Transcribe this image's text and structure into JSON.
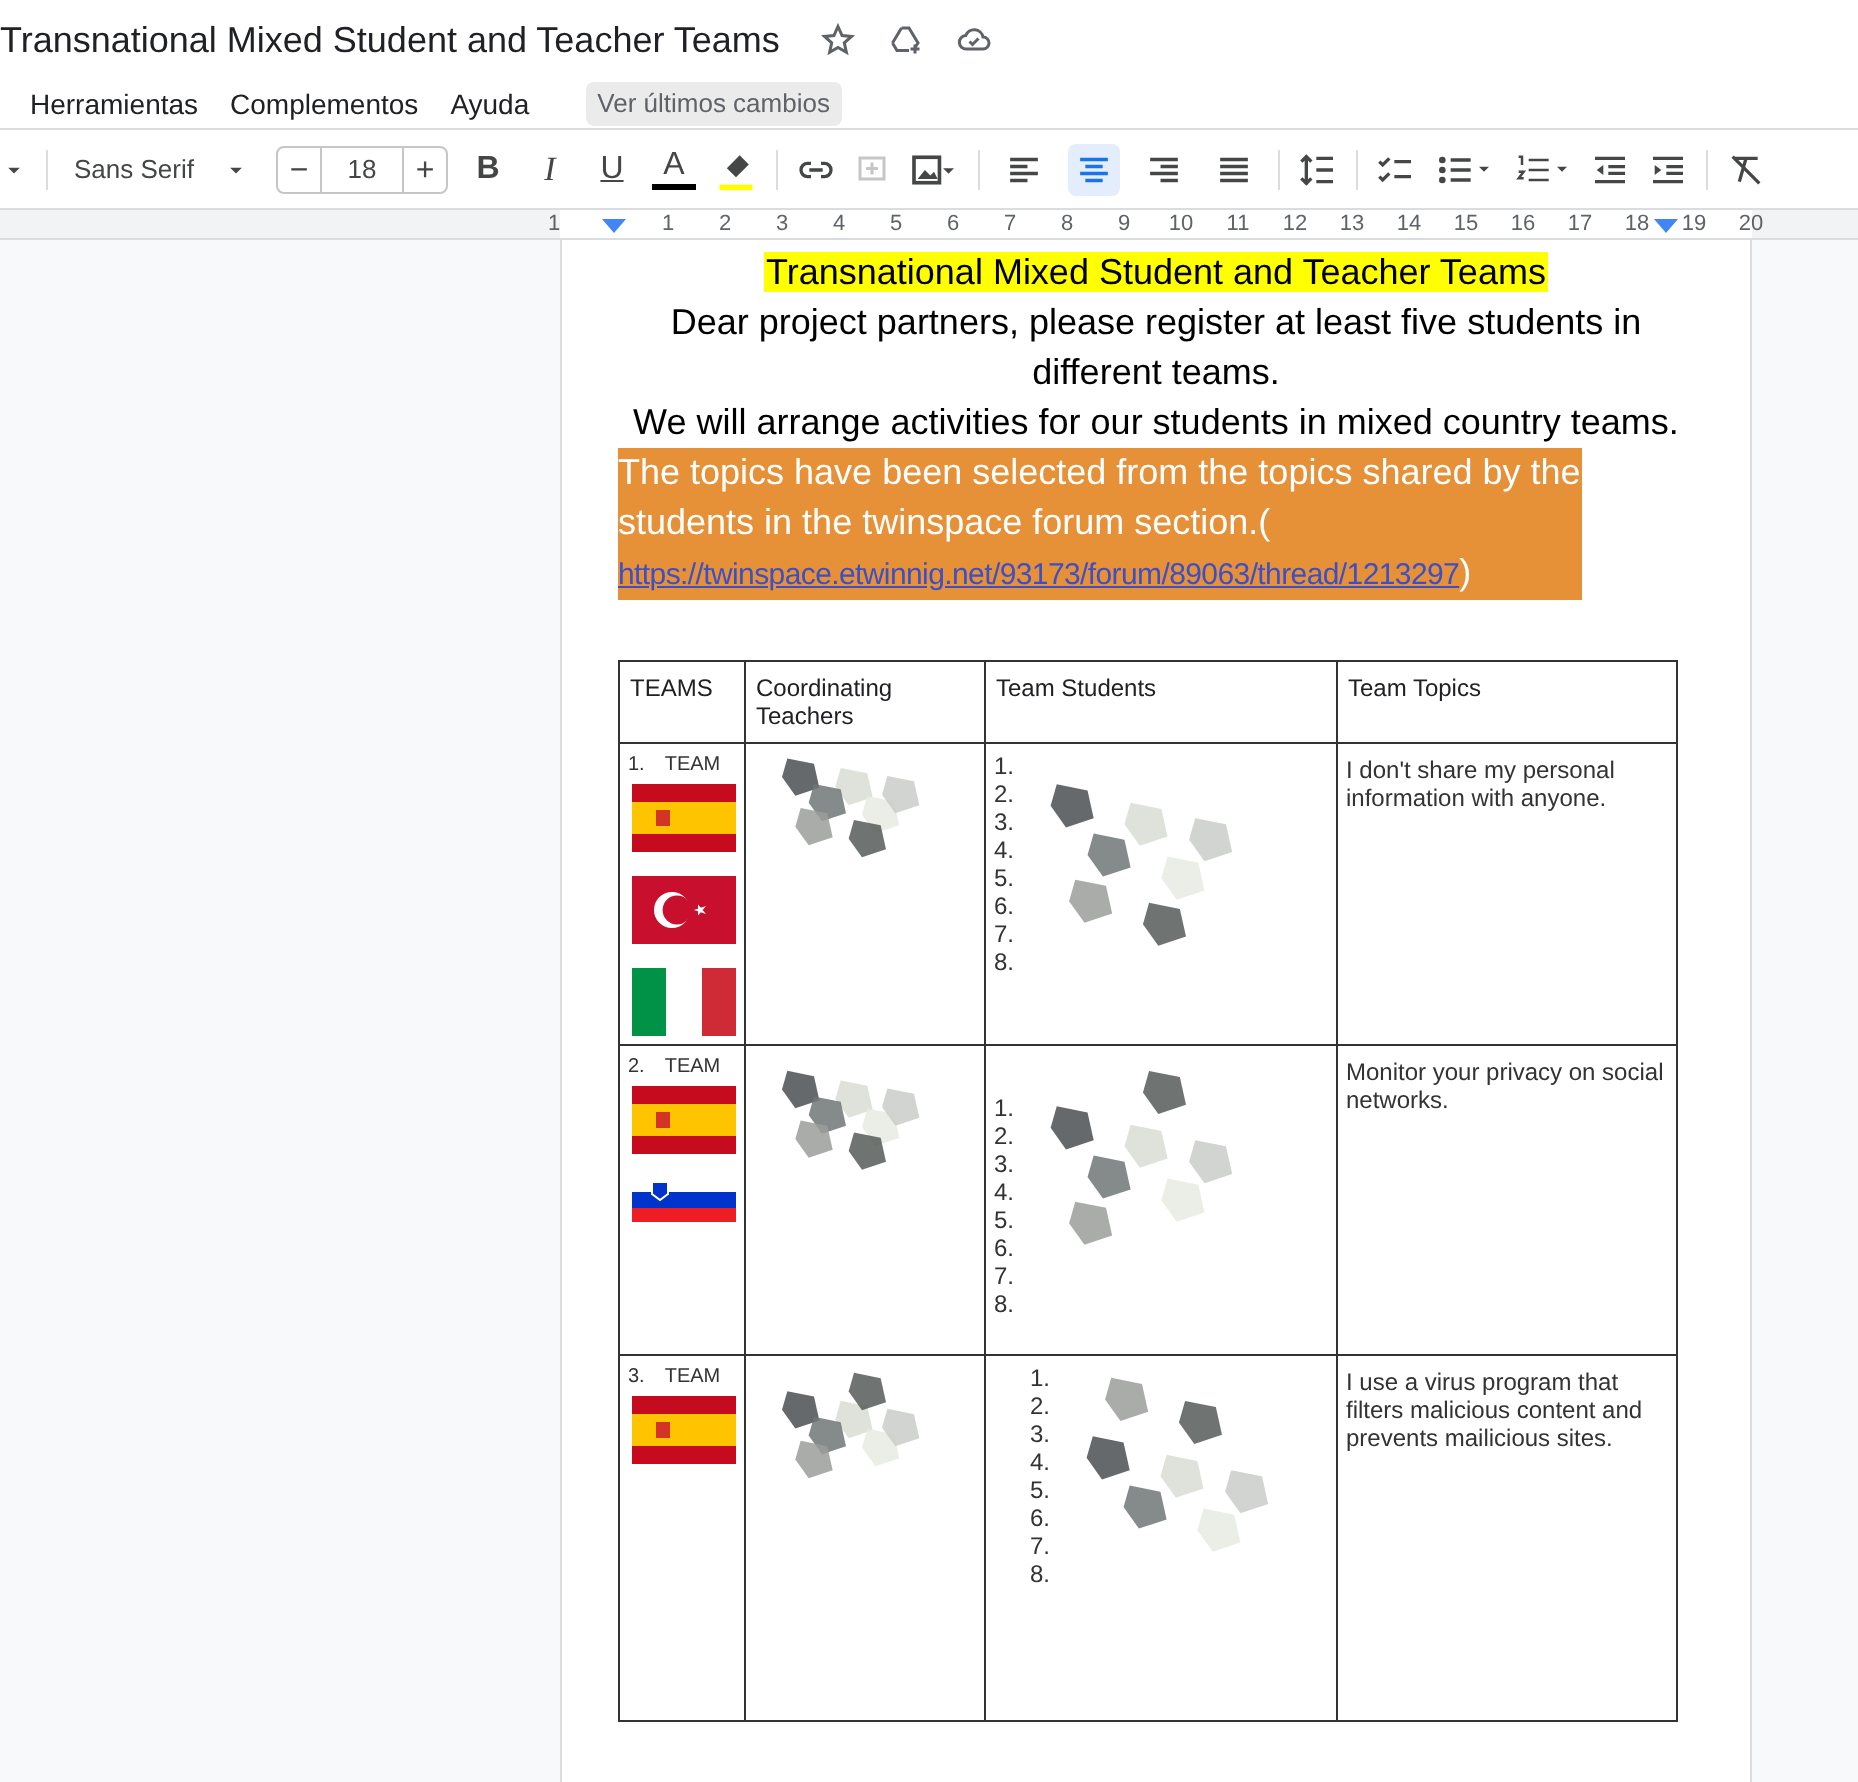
{
  "document_title": "Transnational Mixed Student and Teacher Teams",
  "menu": [
    "Herramientas",
    "Complementos",
    "Ayuda"
  ],
  "changes_link": "Ver últimos cambios",
  "toolbar": {
    "font": "Sans Serif",
    "font_size": "18",
    "decrease": "−",
    "increase": "+",
    "bold": "B",
    "italic": "I",
    "underline": "U",
    "text_color": "A",
    "alignment": [
      {
        "kind": "left",
        "selected": false
      },
      {
        "kind": "center",
        "selected": true
      },
      {
        "kind": "right",
        "selected": false
      },
      {
        "kind": "justify",
        "selected": false
      }
    ]
  },
  "ruler": [
    "1",
    "1",
    "2",
    "3",
    "4",
    "5",
    "6",
    "7",
    "8",
    "9",
    "10",
    "11",
    "12",
    "13",
    "14",
    "15",
    "16",
    "17",
    "18",
    "19",
    "20"
  ],
  "doc": {
    "heading": "Transnational Mixed Student and Teacher Teams",
    "paragraphs": [
      "Dear project partners, please register at least five students in different teams.",
      "We will arrange activities for our students in mixed country teams."
    ],
    "highlighted": {
      "text": "The topics have been selected from the topics shared by the students in the twinspace forum section.(",
      "link": "https://twinspace.etwinnig.net/93173/forum/89063/thread/1213297",
      "after": ")"
    }
  },
  "table": {
    "columns": [
      "TEAMS",
      "Coordinating Teachers",
      "Team Students",
      "Team Topics"
    ],
    "rows": [
      {
        "number": "1.",
        "team": "TEAM",
        "flags": [
          {
            "kind": "spain"
          },
          {
            "kind": "turkey"
          },
          {
            "kind": "italy"
          }
        ],
        "student_numbers": [
          "1.",
          "2.",
          "3.",
          "4.",
          "5.",
          "6.",
          "7.",
          "8."
        ],
        "topic": "I don't share my personal information with anyone."
      },
      {
        "number": "2.",
        "team": "TEAM",
        "flags": [
          {
            "kind": "spain"
          },
          {
            "kind": "slovenia"
          }
        ],
        "student_numbers": [
          "1.",
          "2.",
          "3.",
          "4.",
          "5.",
          "6.",
          "7.",
          "8."
        ],
        "topic": "Monitor your privacy on social networks."
      },
      {
        "number": "3.",
        "team": "TEAM",
        "flags": [
          {
            "kind": "spain"
          }
        ],
        "student_numbers": [
          "1.",
          "2.",
          "3.",
          "4.",
          "5.",
          "6.",
          "7.",
          "8."
        ],
        "topic": "I use a virus program that filters malicious content and prevents mailicious sites."
      }
    ]
  }
}
